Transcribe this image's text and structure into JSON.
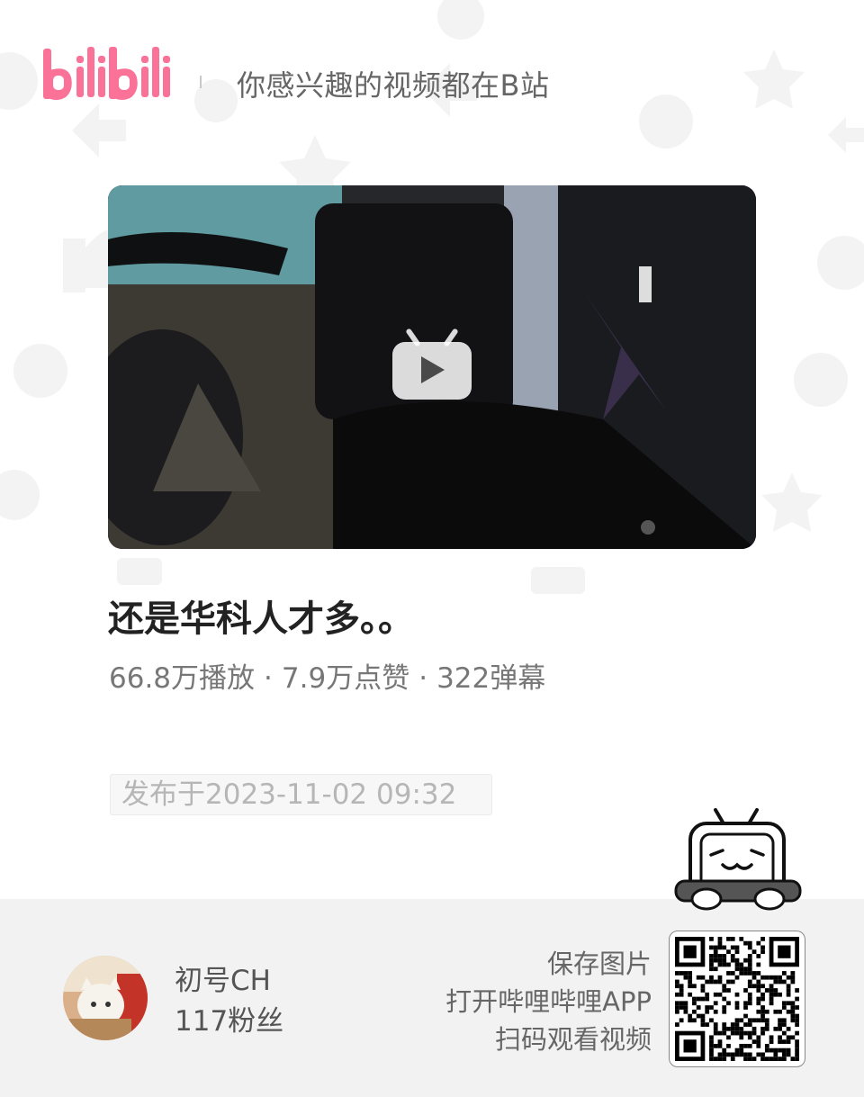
{
  "header": {
    "logo_text": "bilibili",
    "tagline": "你感兴趣的视频都在B站"
  },
  "video": {
    "thumbnail_icon": "play-icon",
    "title": "还是华科人才多。。",
    "views": "66.8万播放",
    "likes": "7.9万点赞",
    "danmaku": "322弹幕",
    "separator": "·",
    "publish_date": "发布于2023-11-02 09:32"
  },
  "uploader": {
    "name": "初号CH",
    "fans": "117粉丝"
  },
  "cta": {
    "line1": "保存图片",
    "line2": "打开哔哩哔哩APP",
    "line3": "扫码观看视频"
  },
  "colors": {
    "brand_pink": "#fb7299",
    "text_dark": "#222222",
    "text_gray": "#777777",
    "footer_bg": "#f2f2f3"
  }
}
